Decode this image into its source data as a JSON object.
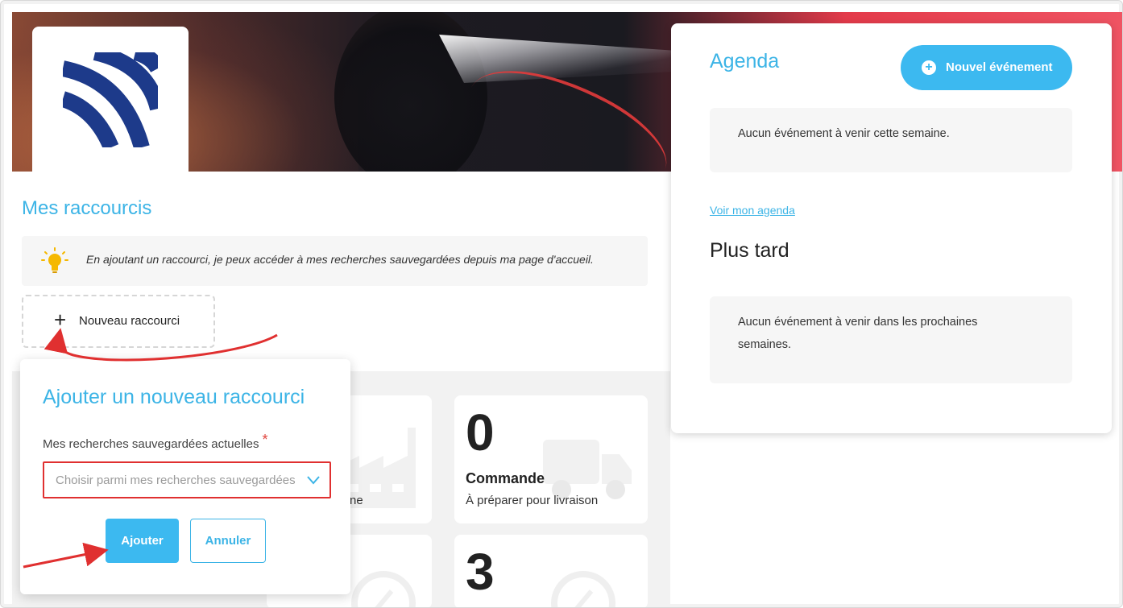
{
  "shortcuts": {
    "title": "Mes raccourcis",
    "tip": "En ajoutant un raccourci, je peux accéder à mes recherches sauvegardées depuis ma page d'accueil.",
    "new_label": "Nouveau raccourci",
    "new_icon": "plus-icon"
  },
  "agenda": {
    "title": "Agenda",
    "new_event_label": "Nouvel événement",
    "this_week_empty": "Aucun événement à venir cette semaine.",
    "view_link": "Voir mon agenda",
    "later_title": "Plus tard",
    "later_empty": "Aucun événement à venir dans les prochaines semaines."
  },
  "tiles": [
    {
      "number": "0",
      "title": "Commande",
      "subtitle": "À préparer pour livraison",
      "icon": "truck-icon"
    },
    {
      "number": "3",
      "icon": "gauge-icon"
    }
  ],
  "partial_tile_text": "ne",
  "modal": {
    "title": "Ajouter un nouveau raccourci",
    "field_label": "Mes recherches sauvegardées actuelles",
    "required_mark": "*",
    "select_placeholder": "Choisir parmi mes recherches sauvegardées",
    "add_label": "Ajouter",
    "cancel_label": "Annuler"
  },
  "colors": {
    "accent": "#3cb4e6",
    "button": "#3cb9f0",
    "annotation": "#e03030",
    "logo": "#1d3a8a"
  }
}
